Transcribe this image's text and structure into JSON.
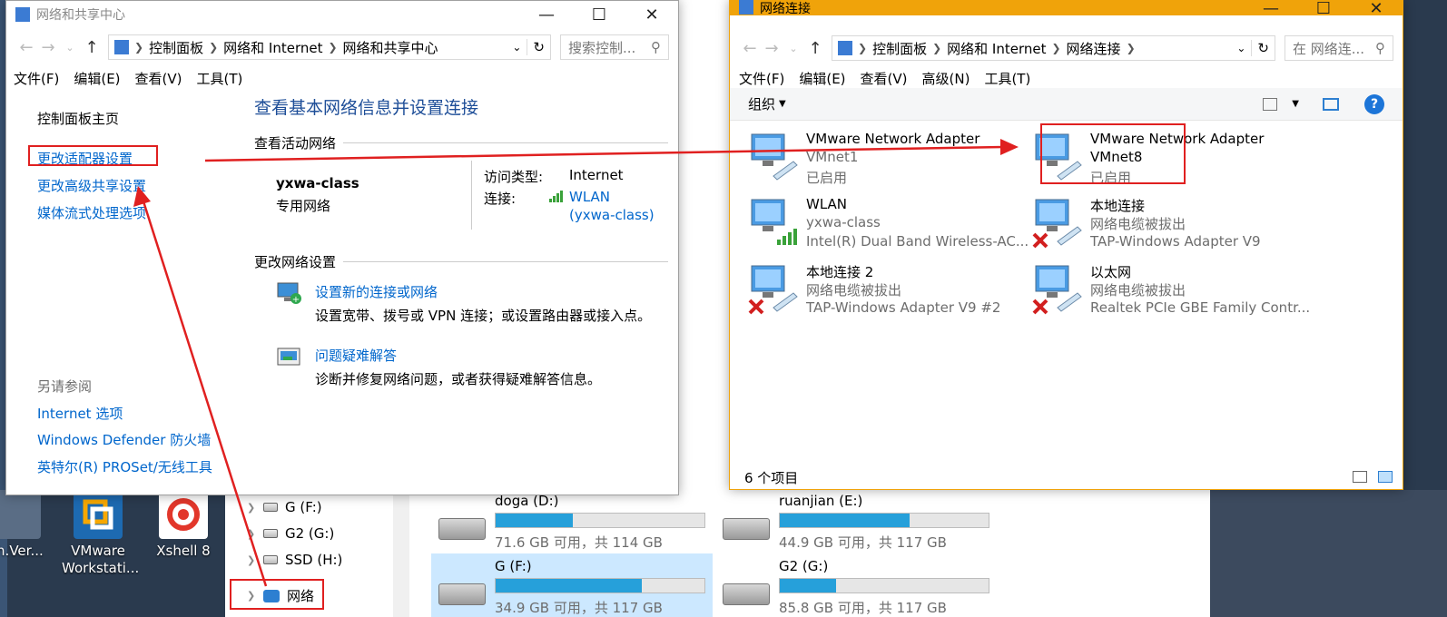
{
  "desktop": {
    "icons": [
      {
        "label": "sh.Ver..."
      },
      {
        "label": "VMware Workstati..."
      },
      {
        "label": "Xshell 8"
      }
    ]
  },
  "explorer": {
    "nav_items": [
      {
        "label": "G (F:)"
      },
      {
        "label": "G2 (G:)"
      },
      {
        "label": "SSD (H:)"
      },
      {
        "label": "网络"
      }
    ],
    "drives": [
      {
        "name": "doga (D:)",
        "size": "71.6 GB 可用，共 114 GB",
        "used": 0.37
      },
      {
        "name": "ruanjian (E:)",
        "size": "44.9 GB 可用，共 117 GB",
        "used": 0.62
      },
      {
        "name": "G (F:)",
        "size": "34.9 GB 可用，共 117 GB",
        "used": 0.7
      },
      {
        "name": "G2 (G:)",
        "size": "85.8 GB 可用，共 117 GB",
        "used": 0.27
      }
    ]
  },
  "nsc": {
    "title": "网络和共享中心",
    "breadcrumbs": [
      "控制面板",
      "网络和 Internet",
      "网络和共享中心"
    ],
    "search_placeholder": "搜索控制...",
    "menu": [
      "文件(F)",
      "编辑(E)",
      "查看(V)",
      "工具(T)"
    ],
    "sidebar": {
      "home": "控制面板主页",
      "links": [
        "更改适配器设置",
        "更改高级共享设置",
        "媒体流式处理选项"
      ],
      "see_also_header": "另请参阅",
      "see_also": [
        "Internet 选项",
        "Windows Defender 防火墙",
        "英特尔(R) PROSet/无线工具"
      ]
    },
    "heading": "查看基本网络信息并设置连接",
    "active_header": "查看活动网络",
    "network_name": "yxwa-class",
    "network_type": "专用网络",
    "access_label": "访问类型:",
    "access_value": "Internet",
    "conn_label": "连接:",
    "conn_value": "WLAN",
    "conn_sub": "(yxwa-class)",
    "change_header": "更改网络设置",
    "tasks": [
      {
        "title": "设置新的连接或网络",
        "desc": "设置宽带、拨号或 VPN 连接；或设置路由器或接入点。"
      },
      {
        "title": "问题疑难解答",
        "desc": "诊断并修复网络问题，或者获得疑难解答信息。"
      }
    ]
  },
  "nc": {
    "title": "网络连接",
    "breadcrumbs": [
      "控制面板",
      "网络和 Internet",
      "网络连接"
    ],
    "search_placeholder": "在 网络连...",
    "menu": [
      "文件(F)",
      "编辑(E)",
      "查看(V)",
      "高级(N)",
      "工具(T)"
    ],
    "organize": "组织",
    "adapters": [
      {
        "name": "VMware Network Adapter",
        "sub": "VMnet1",
        "status": "已启用",
        "icon": "network-adapter-icon"
      },
      {
        "name": "VMware Network Adapter",
        "sub": "VMnet8",
        "status": "已启用",
        "icon": "network-adapter-icon"
      },
      {
        "name": "WLAN",
        "sub": "yxwa-class",
        "status": "Intel(R) Dual Band Wireless-AC...",
        "icon": "wireless-adapter-icon"
      },
      {
        "name": "本地连接",
        "sub": "网络电缆被拔出",
        "status": "TAP-Windows Adapter V9",
        "icon": "disconnected-adapter-icon"
      },
      {
        "name": "本地连接 2",
        "sub": "网络电缆被拔出",
        "status": "TAP-Windows Adapter V9 #2",
        "icon": "disconnected-adapter-icon"
      },
      {
        "name": "以太网",
        "sub": "网络电缆被拔出",
        "status": "Realtek PCIe GBE Family Contr...",
        "icon": "disconnected-adapter-icon"
      }
    ],
    "item_count": "6 个项目"
  },
  "colors": {
    "accent": "#f0a30a",
    "link": "#0066cc",
    "highlight": "#e02020",
    "bar": "#26a0da"
  }
}
